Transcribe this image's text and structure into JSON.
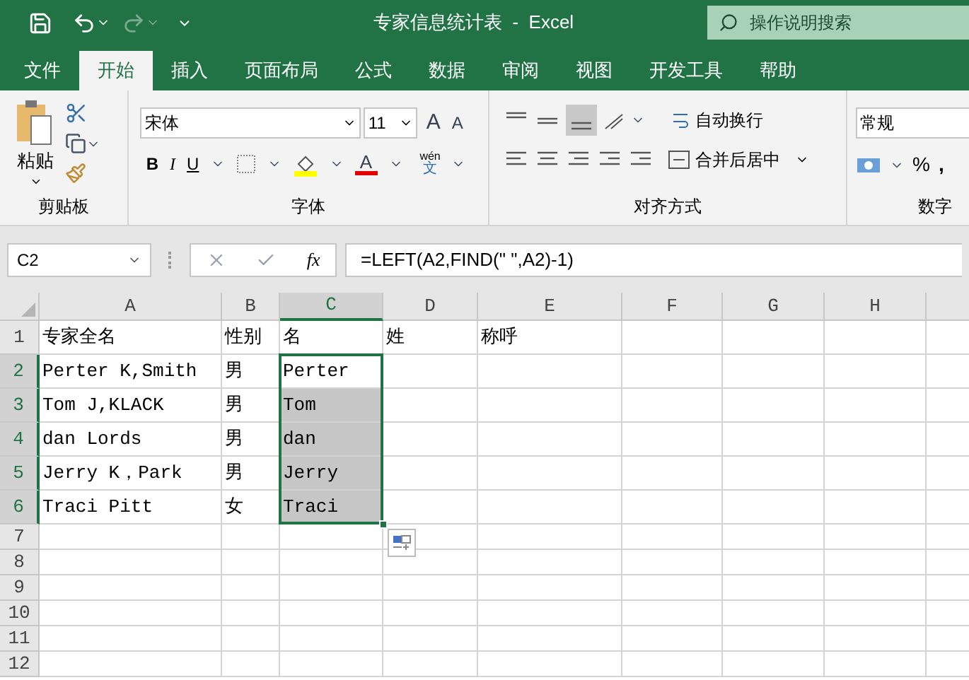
{
  "window": {
    "title": "专家信息统计表  -  Excel"
  },
  "search": {
    "placeholder": "操作说明搜索"
  },
  "tabs": [
    {
      "label": "文件",
      "selected": false
    },
    {
      "label": "开始",
      "selected": true
    },
    {
      "label": "插入",
      "selected": false
    },
    {
      "label": "页面布局",
      "selected": false
    },
    {
      "label": "公式",
      "selected": false
    },
    {
      "label": "数据",
      "selected": false
    },
    {
      "label": "审阅",
      "selected": false
    },
    {
      "label": "视图",
      "selected": false
    },
    {
      "label": "开发工具",
      "selected": false
    },
    {
      "label": "帮助",
      "selected": false
    }
  ],
  "ribbon": {
    "clipboard": {
      "paste": "粘贴",
      "label": "剪贴板"
    },
    "font": {
      "name": "宋体",
      "size": "11",
      "grow": "A",
      "shrink": "A",
      "bold": "B",
      "italic": "I",
      "underline": "U",
      "color_letter": "A",
      "phonetic_top": "wén",
      "phonetic_bottom": "文",
      "label": "字体"
    },
    "alignment": {
      "wrap": "自动换行",
      "merge": "合并后居中",
      "label": "对齐方式"
    },
    "number": {
      "format": "常规",
      "percent": "%",
      "comma": ",",
      "label": "数字"
    }
  },
  "formula_bar": {
    "name_box": "C2",
    "fx": "fx",
    "formula": "=LEFT(A2,FIND(\" \",A2)-1)"
  },
  "sheet": {
    "columns": [
      {
        "label": "A",
        "selected": false
      },
      {
        "label": "B",
        "selected": false
      },
      {
        "label": "C",
        "selected": true
      },
      {
        "label": "D",
        "selected": false
      },
      {
        "label": "E",
        "selected": false
      },
      {
        "label": "F",
        "selected": false
      },
      {
        "label": "G",
        "selected": false
      },
      {
        "label": "H",
        "selected": false
      }
    ],
    "rows": [
      {
        "label": "1",
        "selected": false,
        "cells": {
          "A": "专家全名",
          "B": "性别",
          "C": "名",
          "D": "姓",
          "E": "称呼"
        }
      },
      {
        "label": "2",
        "selected": true,
        "cells": {
          "A": "Perter K,Smith",
          "B": "男",
          "C": "Perter"
        }
      },
      {
        "label": "3",
        "selected": true,
        "cells": {
          "A": "Tom J,KLACK",
          "B": "男",
          "C": "Tom"
        }
      },
      {
        "label": "4",
        "selected": true,
        "cells": {
          "A": "dan Lords",
          "B": "男",
          "C": "dan"
        }
      },
      {
        "label": "5",
        "selected": true,
        "cells": {
          "A": "Jerry K，Park",
          "B": "男",
          "C": "Jerry"
        }
      },
      {
        "label": "6",
        "selected": true,
        "cells": {
          "A": "Traci Pitt",
          "B": "女",
          "C": "Traci"
        }
      },
      {
        "label": "7",
        "selected": false,
        "cells": {}
      },
      {
        "label": "8",
        "selected": false,
        "cells": {}
      },
      {
        "label": "9",
        "selected": false,
        "cells": {}
      },
      {
        "label": "10",
        "selected": false,
        "cells": {}
      },
      {
        "label": "11",
        "selected": false,
        "cells": {}
      },
      {
        "label": "12",
        "selected": false,
        "cells": {}
      }
    ]
  }
}
